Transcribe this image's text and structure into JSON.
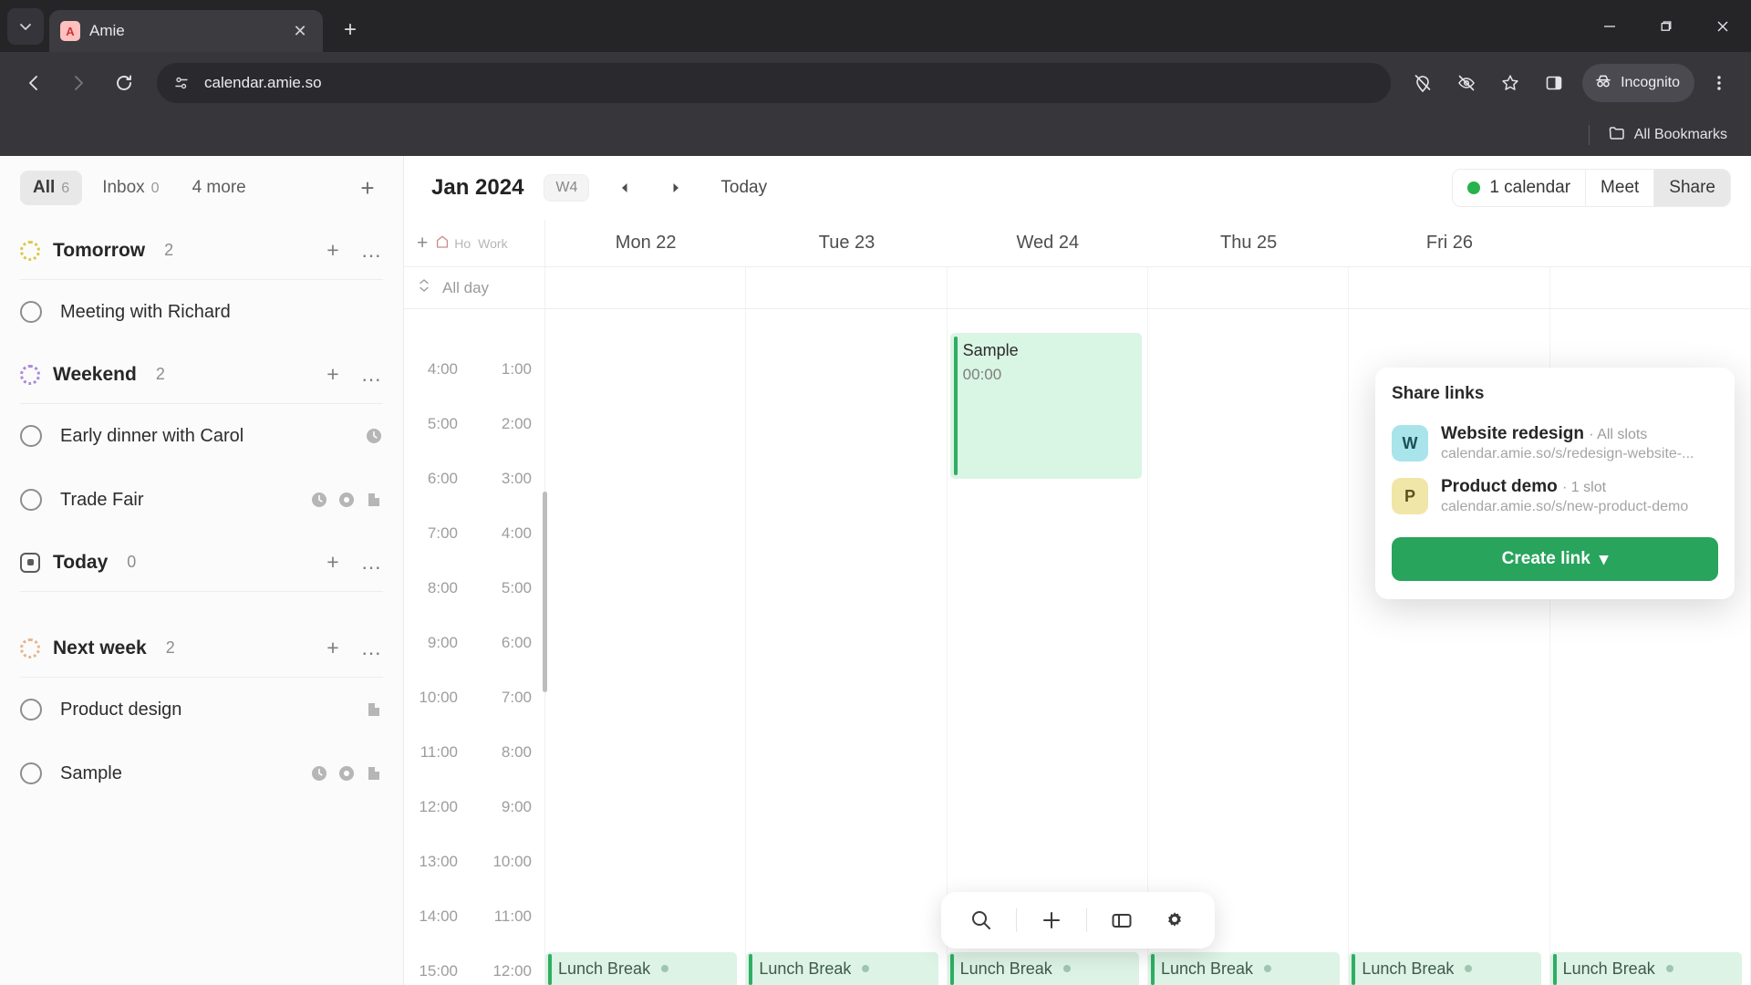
{
  "browser": {
    "tab": {
      "title": "Amie",
      "favicon_letter": "A"
    },
    "tab_list_icon": "chevron-down-icon",
    "new_tab_label": "+",
    "close_label": "✕",
    "url": "calendar.amie.so",
    "omnibox_icon": "site-settings-icon",
    "nav": {
      "back": "←",
      "forward": "→",
      "reload": "⟳"
    },
    "toolbar_icons": [
      "location-off-icon",
      "eye-off-icon",
      "bookmark-star-icon",
      "side-panel-icon"
    ],
    "profile_chip": "Incognito",
    "menu_icon": "three-dot-menu-icon",
    "bookmarks_label": "All Bookmarks",
    "window_controls": {
      "minimize": "─",
      "maximize": "❐",
      "close": "✕"
    }
  },
  "sidebar": {
    "filters": [
      {
        "label": "All",
        "count": "6",
        "active": true
      },
      {
        "label": "Inbox",
        "count": "0",
        "active": false
      },
      {
        "label": "4 more",
        "count": "",
        "active": false
      }
    ],
    "add_label": "+",
    "groups": [
      {
        "title": "Tomorrow",
        "count": "2",
        "icon": "dotted-circle-yellow-icon",
        "icon_variant": "yellow",
        "add": "+",
        "more": "…",
        "tasks": [
          {
            "title": "Meeting with Richard",
            "badges": []
          }
        ]
      },
      {
        "title": "Weekend",
        "count": "2",
        "icon": "dotted-circle-purple-icon",
        "icon_variant": "purple",
        "add": "+",
        "more": "…",
        "tasks": [
          {
            "title": "Early dinner with Carol",
            "badges": [
              "clock-icon"
            ]
          },
          {
            "title": "Trade Fair",
            "badges": [
              "clock-icon",
              "record-circle-icon",
              "document-icon"
            ]
          }
        ]
      },
      {
        "title": "Today",
        "count": "0",
        "icon": "today-square-icon",
        "icon_variant": "today",
        "add": "+",
        "more": "…",
        "tasks": []
      },
      {
        "title": "Next week",
        "count": "2",
        "icon": "dotted-circle-orange-icon",
        "icon_variant": "orange",
        "add": "+",
        "more": "…",
        "tasks": [
          {
            "title": "Product design",
            "badges": [
              "document-icon"
            ]
          },
          {
            "title": "Sample",
            "badges": [
              "clock-icon",
              "record-circle-icon",
              "document-icon"
            ]
          }
        ]
      }
    ]
  },
  "calendar": {
    "month": "Jan 2024",
    "week_pill": "W4",
    "prev_label": "◀",
    "next_label": "▶",
    "today_label": "Today",
    "calendars_chip": "1 calendar",
    "calendars_dot_color": "#27b24b",
    "meet_label": "Meet",
    "share_label": "Share",
    "gutter": {
      "add_label": "+",
      "home_icon": "house-icon",
      "home_label": "Ho",
      "work_label": "Work",
      "allday_label": "All day",
      "allday_icon": "collapse-icon"
    },
    "days": [
      {
        "label": "Mon 22"
      },
      {
        "label": "Tue 23"
      },
      {
        "label": "Wed 24"
      },
      {
        "label": "Thu 25"
      },
      {
        "label": "Fri 26"
      }
    ],
    "time_labels_primary": [
      "4:00",
      "5:00",
      "6:00",
      "7:00",
      "8:00",
      "9:00",
      "10:00",
      "11:00",
      "12:00",
      "13:00",
      "14:00",
      "15:00"
    ],
    "time_labels_secondary": [
      "1:00",
      "2:00",
      "3:00",
      "4:00",
      "5:00",
      "6:00",
      "7:00",
      "8:00",
      "9:00",
      "10:00",
      "11:00",
      "12:00"
    ],
    "events": [
      {
        "title": "Sample",
        "time": "00:00",
        "day_index": 2,
        "color": "#2fae63"
      }
    ],
    "lunch_label": "Lunch Break",
    "lunch_days": 6
  },
  "dock": {
    "buttons": [
      {
        "icon": "search-icon",
        "label": ""
      },
      {
        "icon": "plus-icon",
        "label": ""
      },
      {
        "icon": "panel-icon",
        "label": ""
      },
      {
        "icon": "gear-icon",
        "label": ""
      }
    ]
  },
  "share_popover": {
    "title": "Share links",
    "links": [
      {
        "avatar": "W",
        "avatar_color": "blue",
        "name": "Website redesign",
        "slots": "· All slots",
        "url": "calendar.amie.so/s/redesign-website-..."
      },
      {
        "avatar": "P",
        "avatar_color": "yellow",
        "name": "Product demo",
        "slots": "· 1 slot",
        "url": "calendar.amie.so/s/new-product-demo"
      }
    ],
    "create_label": "Create link",
    "create_caret": "▾"
  }
}
